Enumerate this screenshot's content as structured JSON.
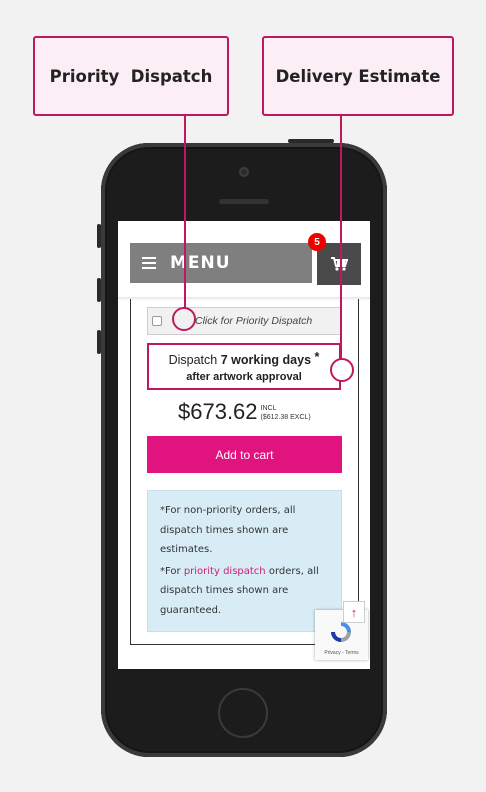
{
  "callouts": {
    "priority": "Priority  Dispatch",
    "delivery": "Delivery Estimate"
  },
  "header": {
    "menu_label": "MENU",
    "cart_count": "5",
    "icons": {
      "menu": "hamburger-icon",
      "cart": "cart-icon"
    }
  },
  "product": {
    "priority_checkbox_label": "Click for Priority Dispatch",
    "priority_checked": false,
    "dispatch_prefix": "Dispatch",
    "dispatch_days": "7 working days",
    "dispatch_star": "*",
    "dispatch_suffix": "after artwork approval",
    "price": "$673.62",
    "price_incl": "INCL",
    "price_excl": "($612.38 EXCL)",
    "add_to_cart": "Add to cart"
  },
  "notice": {
    "line1": "*For non-priority orders, all dispatch times shown are estimates.",
    "line2_prefix": "*For",
    "line2_link": "priority dispatch",
    "line2_suffix": "orders, all dispatch times shown are guaranteed."
  },
  "recaptcha": {
    "terms": "Privacy - Terms"
  },
  "colors": {
    "accent": "#e0137f",
    "callout_border": "#c0185e",
    "notice_bg": "#d8ecf6",
    "menu_bg": "#7f7f7f"
  }
}
